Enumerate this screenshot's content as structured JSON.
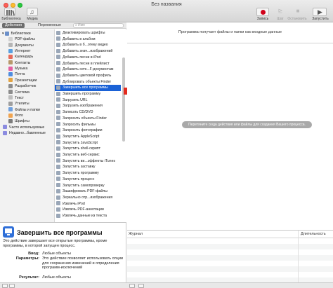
{
  "window": {
    "title": "Без названия"
  },
  "toolbar": {
    "library_label": "Библиотека",
    "media_label": "Медиа",
    "record_label": "Запись",
    "step_label": "Шаг",
    "stop_label": "Остановить",
    "run_label": "Запустить"
  },
  "tabs": {
    "actions": "Действия",
    "variables": "Переменные",
    "search_placeholder": "Имя"
  },
  "library": [
    {
      "label": "Библиотеки",
      "color": "#6b8fc9",
      "indent": 0
    },
    {
      "label": "PDF-файлы",
      "color": "#d0d0d0",
      "indent": 1
    },
    {
      "label": "Документы",
      "color": "#b5b5b5",
      "indent": 1
    },
    {
      "label": "Интернет",
      "color": "#5aa0e0",
      "indent": 1
    },
    {
      "label": "Календарь",
      "color": "#e66a5a",
      "indent": 1
    },
    {
      "label": "Контакты",
      "color": "#b7986b",
      "indent": 1
    },
    {
      "label": "Музыка",
      "color": "#e45fa0",
      "indent": 1
    },
    {
      "label": "Почта",
      "color": "#4f8de0",
      "indent": 1
    },
    {
      "label": "Презентации",
      "color": "#e3a443",
      "indent": 1
    },
    {
      "label": "Разработчик",
      "color": "#8c8c8c",
      "indent": 1
    },
    {
      "label": "Система",
      "color": "#8c8c8c",
      "indent": 1
    },
    {
      "label": "Текст",
      "color": "#bdbdbd",
      "indent": 1
    },
    {
      "label": "Утилиты",
      "color": "#9e9e9e",
      "indent": 1
    },
    {
      "label": "Файлы и папки",
      "color": "#6fa0de",
      "indent": 1
    },
    {
      "label": "Фото",
      "color": "#f0a450",
      "indent": 1
    },
    {
      "label": "Шрифты",
      "color": "#7c7c7c",
      "indent": 1
    },
    {
      "label": "Часто используемые",
      "color": "#8b8be0",
      "indent": 0
    },
    {
      "label": "Недавно...бавленные",
      "color": "#8b8be0",
      "indent": 0
    }
  ],
  "actions": [
    "Деактивировать шрифты",
    "Добавить в альбом",
    "Добавить в б...отеку видео",
    "Добавить знач...изображений",
    "Добавить песни в iPod",
    "Добавить песни в плейлист",
    "Добавить сетк...F-документам",
    "Добавить цветовой профиль",
    "Дублировать объекты Finder",
    "Завершить все программы",
    "Завершить программу",
    "Загрузить URL",
    "Загрузить изображения",
    "Записать CD/DVD",
    "Запросить объекты Finder",
    "Запросить фильмы",
    "Запросить фотографии",
    "Запустить AppleScript",
    "Запустить JavaScript",
    "Запустить shell-скрипт",
    "Запустить веб-сервис",
    "Запустить ви...эффекты iTunes",
    "Запустить заставку",
    "Запустить программу",
    "Запустить процесс",
    "Запустить самопроверку",
    "Зашифровать PDF-файлы",
    "Зеркально отр...изображения",
    "Извлечь iPod",
    "Извлечь PDF-аннотации",
    "Извлечь данные из текста"
  ],
  "selected_action": "Завершить все программы",
  "description": {
    "title": "Завершить все программы",
    "text": "Это действие завершает все открытые программы, кроме программы, в которой запущен процесс.",
    "input_key": "Ввод:",
    "input_val": "Любые объекты",
    "params_key": "Параметры:",
    "params_val": "Это действие позволяет использовать опции для сохранения изменений и определения программ-исключений",
    "result_key": "Результат:",
    "result_val": "Любые объекты"
  },
  "workflow": {
    "header": "Программа получает файлы и папки как входные данные",
    "drop_hint": "Перетяните сюда действия или файлы для создания Вашего процесса."
  },
  "log": {
    "col_journal": "Журнал",
    "col_duration": "Длительность"
  },
  "colors": {
    "selection": "#1b62d6",
    "arrow": "#e32b1f",
    "record": "#d0021b"
  }
}
